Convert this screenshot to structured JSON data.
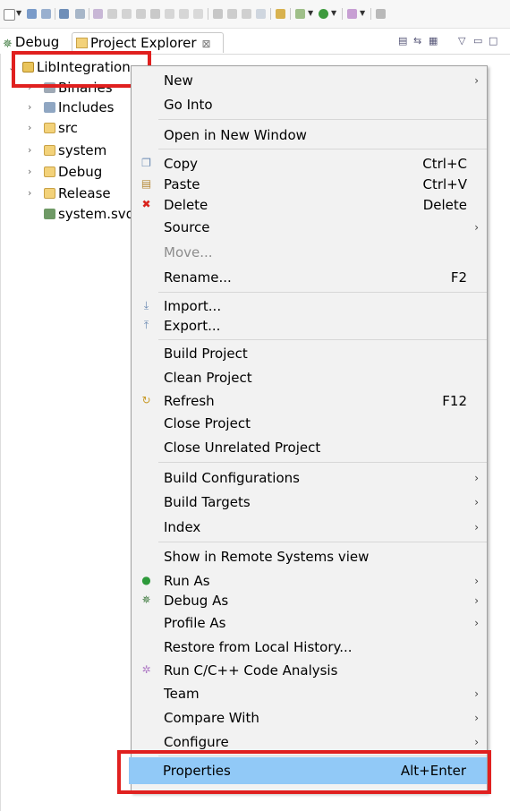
{
  "toolbar": {
    "icons": [
      "new-icon",
      "save-icon",
      "save-all-icon",
      "build-icon",
      "debug-tool-icon",
      "run-icon",
      "search-icon",
      "external-tools-icon"
    ]
  },
  "tabs": {
    "debug_label": "Debug",
    "project_label": "Project Explorer",
    "close_symbol": "⊠"
  },
  "tree": {
    "items": [
      {
        "label": "LibIntegration"
      },
      {
        "label": "Binaries"
      },
      {
        "label": "Includes"
      },
      {
        "label": "src"
      },
      {
        "label": "system"
      },
      {
        "label": "Debug"
      },
      {
        "label": "Release"
      },
      {
        "label": "system.svd"
      }
    ]
  },
  "menu": {
    "items": [
      {
        "label": "New",
        "accel": "",
        "submenu": true,
        "icon": ""
      },
      {
        "label": "Go Into",
        "accel": "",
        "submenu": false,
        "icon": ""
      },
      {
        "label": "Open in New Window",
        "accel": "",
        "submenu": false,
        "icon": ""
      },
      {
        "label": "Copy",
        "accel": "Ctrl+C",
        "submenu": false,
        "icon": "copy-icon"
      },
      {
        "label": "Paste",
        "accel": "Ctrl+V",
        "submenu": false,
        "icon": "paste-icon"
      },
      {
        "label": "Delete",
        "accel": "Delete",
        "submenu": false,
        "icon": "delete-icon"
      },
      {
        "label": "Source",
        "accel": "",
        "submenu": true,
        "icon": ""
      },
      {
        "label": "Move...",
        "accel": "",
        "submenu": false,
        "icon": "",
        "disabled": true
      },
      {
        "label": "Rename...",
        "accel": "F2",
        "submenu": false,
        "icon": ""
      },
      {
        "label": "Import...",
        "accel": "",
        "submenu": false,
        "icon": "import-icon"
      },
      {
        "label": "Export...",
        "accel": "",
        "submenu": false,
        "icon": "export-icon"
      },
      {
        "label": "Build Project",
        "accel": "",
        "submenu": false,
        "icon": ""
      },
      {
        "label": "Clean Project",
        "accel": "",
        "submenu": false,
        "icon": ""
      },
      {
        "label": "Refresh",
        "accel": "F12",
        "submenu": false,
        "icon": "refresh-icon"
      },
      {
        "label": "Close Project",
        "accel": "",
        "submenu": false,
        "icon": ""
      },
      {
        "label": "Close Unrelated Project",
        "accel": "",
        "submenu": false,
        "icon": ""
      },
      {
        "label": "Build Configurations",
        "accel": "",
        "submenu": true,
        "icon": ""
      },
      {
        "label": "Build Targets",
        "accel": "",
        "submenu": true,
        "icon": ""
      },
      {
        "label": "Index",
        "accel": "",
        "submenu": true,
        "icon": ""
      },
      {
        "label": "Show in Remote Systems view",
        "accel": "",
        "submenu": false,
        "icon": ""
      },
      {
        "label": "Run As",
        "accel": "",
        "submenu": true,
        "icon": "run-as-icon"
      },
      {
        "label": "Debug As",
        "accel": "",
        "submenu": true,
        "icon": "debug-as-icon"
      },
      {
        "label": "Profile As",
        "accel": "",
        "submenu": true,
        "icon": ""
      },
      {
        "label": "Restore from Local History...",
        "accel": "",
        "submenu": false,
        "icon": ""
      },
      {
        "label": "Run C/C++ Code Analysis",
        "accel": "",
        "submenu": false,
        "icon": "code-analysis-icon"
      },
      {
        "label": "Team",
        "accel": "",
        "submenu": true,
        "icon": ""
      },
      {
        "label": "Compare With",
        "accel": "",
        "submenu": true,
        "icon": ""
      },
      {
        "label": "Configure",
        "accel": "",
        "submenu": true,
        "icon": ""
      },
      {
        "label": "Properties",
        "accel": "Alt+Enter",
        "submenu": false,
        "icon": "",
        "selected": true
      }
    ]
  },
  "colors": {
    "highlight": "#91c9f7",
    "annotation_red": "#e0201f",
    "menu_bg": "#f2f2f2"
  }
}
